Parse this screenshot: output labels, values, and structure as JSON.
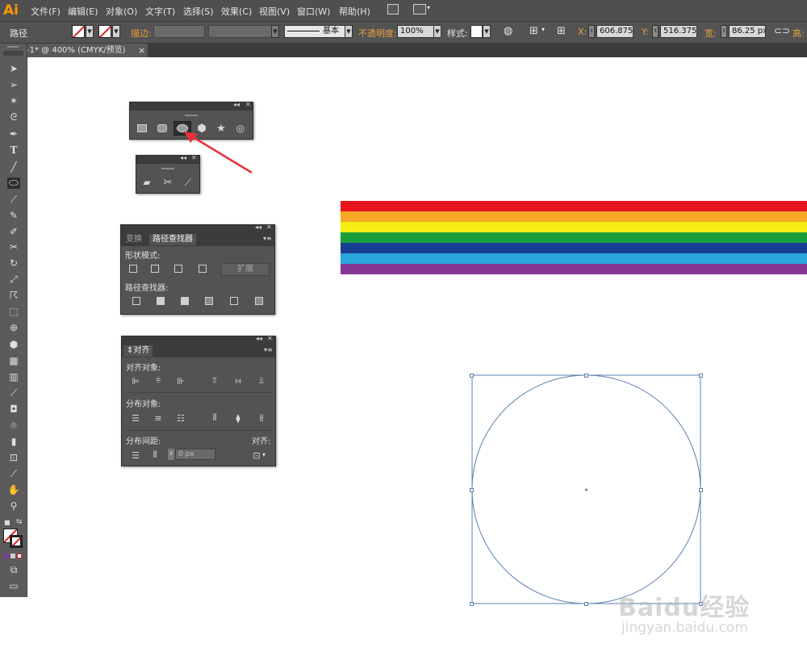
{
  "app": {
    "logo": "Ai"
  },
  "menu": {
    "items": [
      "文件(F)",
      "编辑(E)",
      "对象(O)",
      "文字(T)",
      "选择(S)",
      "效果(C)",
      "视图(V)",
      "窗口(W)",
      "帮助(H)"
    ]
  },
  "control_bar": {
    "selection_label": "路径",
    "stroke_label": "描边:",
    "stroke_style": "基本",
    "opacity_label": "不透明度:",
    "opacity_value": "100%",
    "style_label": "样式:",
    "x_label": "X:",
    "x_value": "606.875",
    "y_label": "Y:",
    "y_value": "516.375",
    "width_label": "宽:",
    "width_value": "86.25 px",
    "height_label": "高:"
  },
  "document_tab": {
    "title": "-1* @ 400% (CMYK/预览)",
    "close": "×"
  },
  "tools": [
    "selection-tool",
    "direct-selection-tool",
    "magic-wand-tool",
    "lasso-tool",
    "pen-tool",
    "type-tool",
    "line-tool",
    "ellipse-tool",
    "paintbrush-tool",
    "pencil-tool",
    "blob-brush-tool",
    "scissors-tool",
    "rotate-tool",
    "scale-tool",
    "warp-tool",
    "free-transform-tool",
    "shape-builder-tool",
    "perspective-tool",
    "mesh-tool",
    "gradient-tool",
    "eyedropper-tool",
    "blend-tool",
    "symbol-sprayer-tool",
    "column-graph-tool",
    "artboard-tool",
    "slice-tool",
    "hand-tool",
    "zoom-tool"
  ],
  "shape_tools_panel": {
    "icons": [
      "rectangle-icon",
      "rounded-rectangle-icon",
      "ellipse-icon",
      "polygon-icon",
      "star-icon",
      "flare-icon"
    ],
    "selected": "ellipse-icon"
  },
  "eraser_tools_panel": {
    "icons": [
      "eraser-icon",
      "scissors-icon",
      "knife-icon"
    ]
  },
  "pathfinder_panel": {
    "tabs": [
      "变换",
      "路径查找器"
    ],
    "active_tab": "路径查找器",
    "shape_modes_label": "形状模式:",
    "expand_button": "扩展",
    "pathfinders_label": "路径查找器:"
  },
  "align_panel": {
    "tab": "对齐",
    "align_objects_label": "对齐对象:",
    "distribute_objects_label": "分布对象:",
    "distribute_spacing_label": "分布间距:",
    "align_to_label": "对齐:",
    "spacing_value": "0 px"
  },
  "artwork": {
    "rainbow_colors": [
      "#e8141b",
      "#f7a827",
      "#f4ec12",
      "#1b9c3c",
      "#183f93",
      "#2aa7dd",
      "#863693"
    ]
  },
  "watermark": {
    "logo": "Baidu经验",
    "url": "jingyan.baidu.com"
  }
}
